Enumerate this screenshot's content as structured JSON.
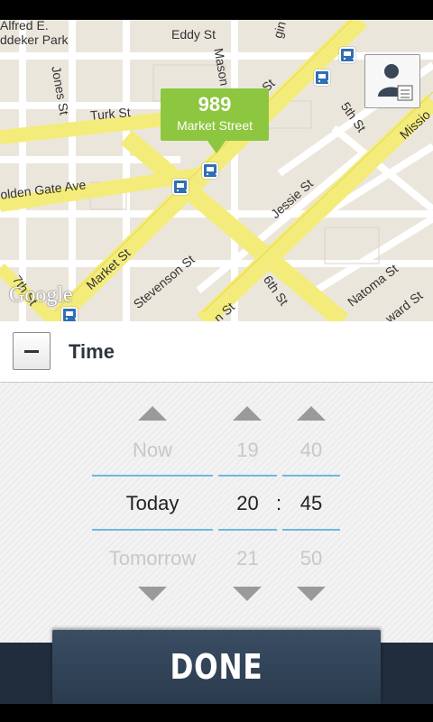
{
  "map": {
    "callout": {
      "stop_id": "989",
      "stop_name": "Market Street"
    },
    "google_logo": "Google",
    "streets": {
      "alfred_park": "Alfred E.",
      "buddeker_park": "ddeker Park",
      "eddy": "Eddy St",
      "mason": "Mason St",
      "jones": "Jones St",
      "turk": "Turk St",
      "golden_gate": "olden Gate Ave",
      "market_left": "Market St",
      "market_top": "Market St",
      "seventh": "7th St",
      "stevenson": "Stevenson St",
      "jessie": "Jessie St",
      "sixth": "6th St",
      "fifth": "5th St",
      "mission": "Missio",
      "natoma": "Natoma St",
      "howard": "ward St",
      "bottom_st": "n St",
      "eighth": "gin St"
    }
  },
  "time_section": {
    "title": "Time",
    "collapse_symbol": "−"
  },
  "picker": {
    "day": {
      "prev": "Now",
      "current": "Today",
      "next": "Tomorrow"
    },
    "hour": {
      "prev": "19",
      "current": "20",
      "next": "21"
    },
    "separator": ":",
    "minute": {
      "prev": "40",
      "current": "45",
      "next": "50"
    }
  },
  "done_label": "DONE",
  "colors": {
    "callout": "#8dc63f",
    "accent_line": "#6fb7de",
    "done_bg": "#2b3b4e",
    "bus": "#2f6fb5"
  }
}
